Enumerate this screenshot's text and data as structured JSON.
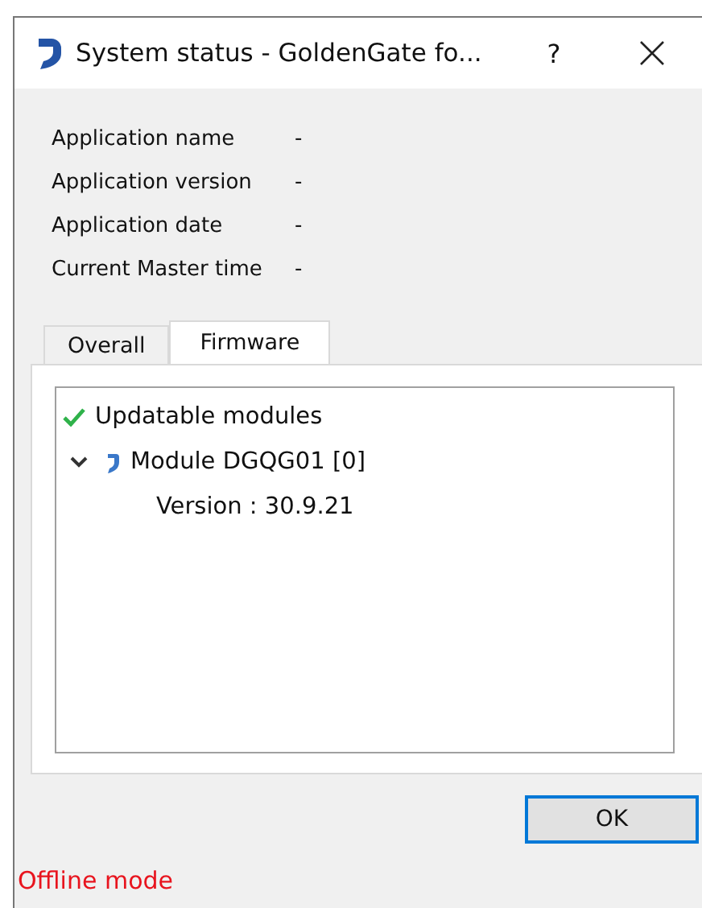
{
  "window": {
    "title": "System status - GoldenGate fo...",
    "help": "?"
  },
  "info": [
    {
      "label": "Application name",
      "value": "-"
    },
    {
      "label": "Application version",
      "value": "-"
    },
    {
      "label": "Application date",
      "value": "-"
    },
    {
      "label": "Current Master time",
      "value": "-"
    }
  ],
  "tabs": [
    {
      "label": "Overall",
      "selected": false
    },
    {
      "label": "Firmware",
      "selected": true
    }
  ],
  "tree": [
    {
      "label": "Updatable modules",
      "children": [
        {
          "label": "Module DGQG01 [0]",
          "expanded": true,
          "children": [
            {
              "label": "Version : 30.9.21"
            }
          ]
        }
      ]
    }
  ],
  "buttons": [
    "OK"
  ],
  "status": "Offline mode"
}
